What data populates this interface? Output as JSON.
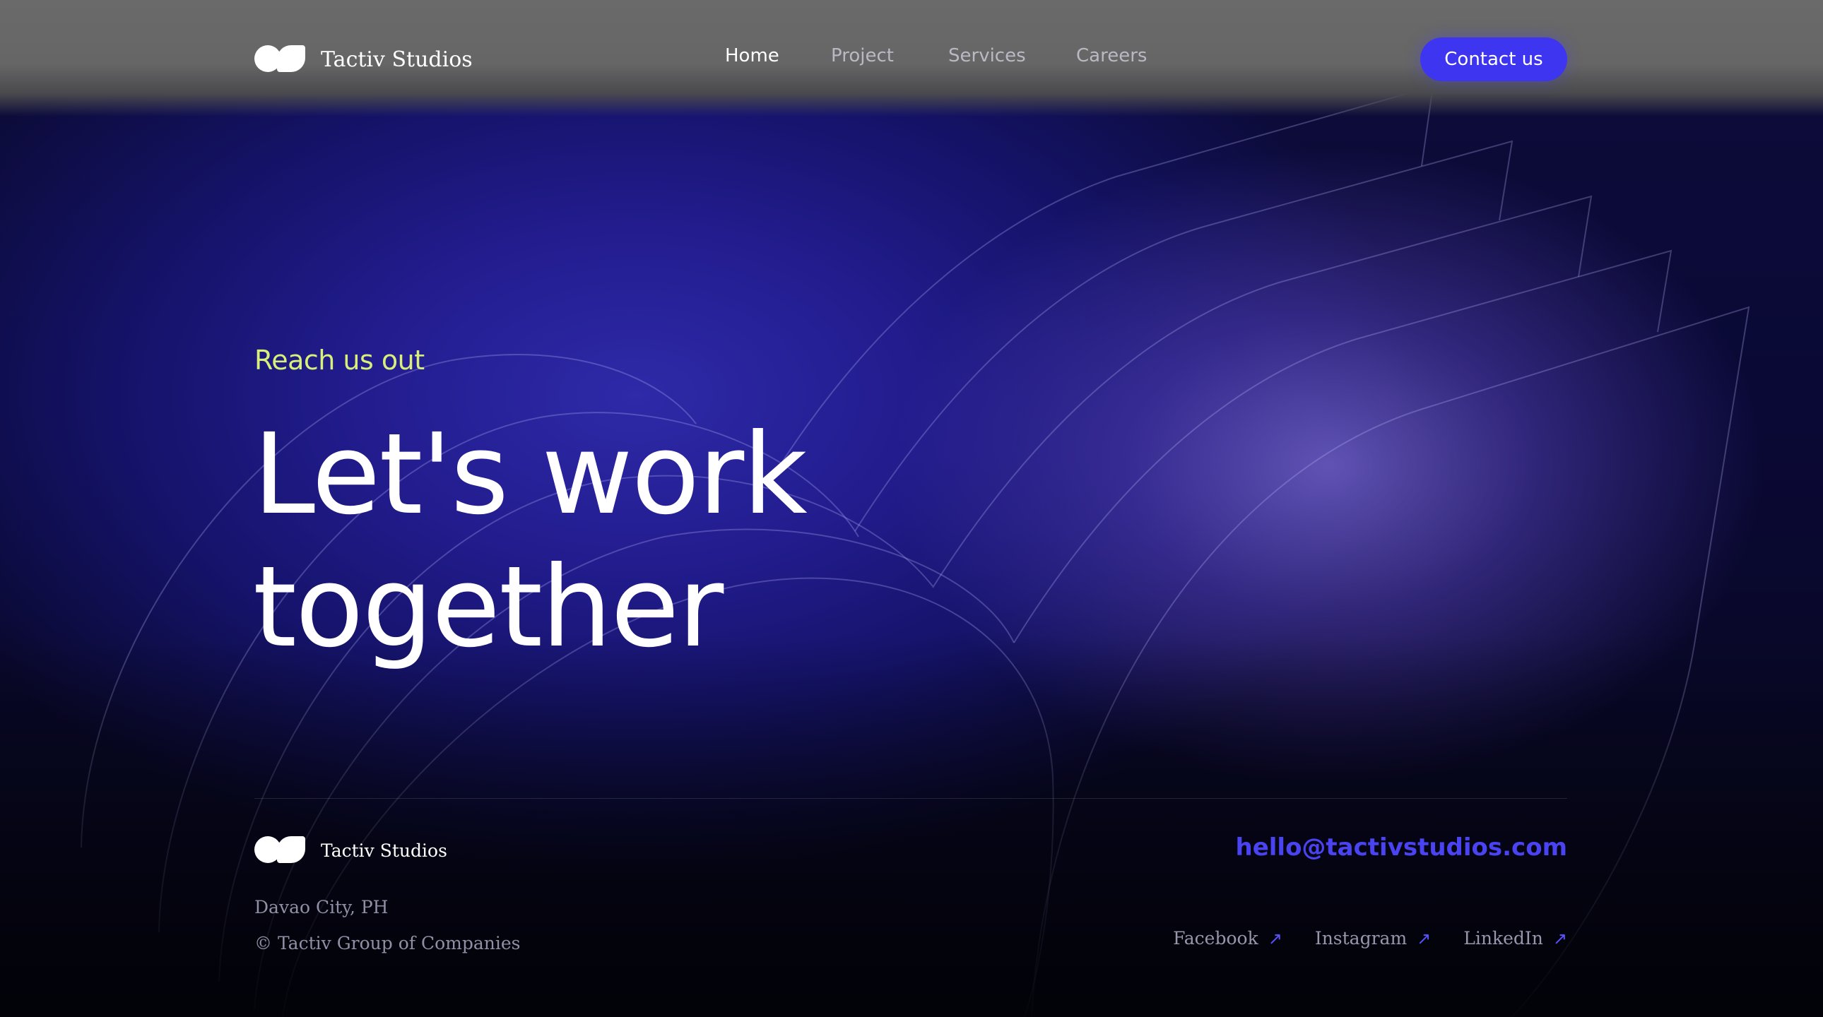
{
  "brand": {
    "name": "Tactiv Studios"
  },
  "nav": {
    "items": [
      {
        "label": "Home",
        "active": true
      },
      {
        "label": "Project",
        "active": false
      },
      {
        "label": "Services",
        "active": false
      },
      {
        "label": "Careers",
        "active": false
      }
    ],
    "cta_label": "Contact us"
  },
  "hero": {
    "eyebrow": "Reach us out",
    "headline_line1": "Let's work",
    "headline_line2": "together"
  },
  "footer": {
    "brand_name": "Tactiv Studios",
    "location": "Davao City, PH",
    "copyright": "© Tactiv Group of Companies",
    "email": "hello@tactivstudios.com",
    "socials": [
      {
        "label": "Facebook",
        "icon": "arrow-up-right-icon"
      },
      {
        "label": "Instagram",
        "icon": "arrow-up-right-icon"
      },
      {
        "label": "LinkedIn",
        "icon": "arrow-up-right-icon"
      }
    ]
  },
  "colors": {
    "accent": "#3d35f0",
    "eyebrow": "#d8f07a",
    "email": "#4a43f2",
    "background": "#14127a"
  }
}
